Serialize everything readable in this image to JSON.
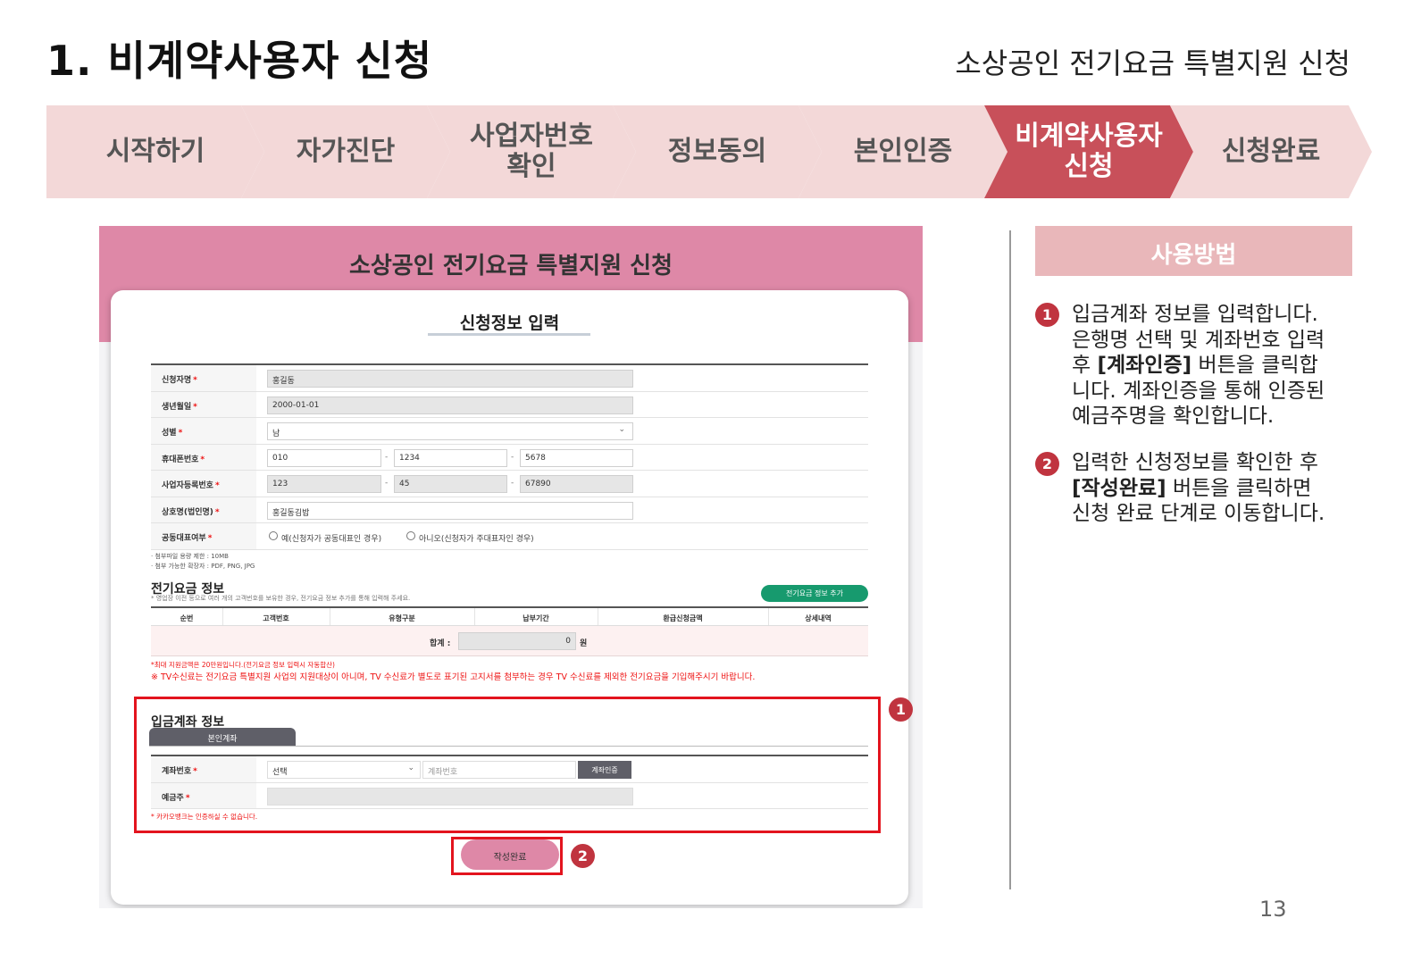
{
  "slide": {
    "title": "1. 비계약사용자 신청",
    "subtitle": "소상공인 전기요금 특별지원 신청",
    "page_number": "13"
  },
  "steps": [
    {
      "label": "시작하기",
      "active": false
    },
    {
      "label": "자가진단",
      "active": false
    },
    {
      "label": "사업자번호\n확인",
      "active": false
    },
    {
      "label": "정보동의",
      "active": false
    },
    {
      "label": "본인인증",
      "active": false
    },
    {
      "label": "비계약사용자\n신청",
      "active": true
    },
    {
      "label": "신청완료",
      "active": false
    }
  ],
  "app": {
    "banner_title": "소상공인 전기요금 특별지원 신청",
    "form_title": "신청정보 입력",
    "required_mark": "*",
    "applicant": {
      "name_label": "신청자명",
      "name_value": "홍길동",
      "birth_label": "생년월일",
      "birth_value": "2000-01-01",
      "gender_label": "성별",
      "gender_value": "남",
      "phone_label": "휴대폰번호",
      "phone_1": "010",
      "phone_2": "1234",
      "phone_3": "5678",
      "bizno_label": "사업자등록번호",
      "bizno_1": "123",
      "bizno_2": "45",
      "bizno_3": "67890",
      "company_label": "상호명(법인명)",
      "company_value": "홍길동김밥",
      "corep_label": "공동대표여부",
      "corep_yes": "예(신청자가 공동대표인 경우)",
      "corep_no": "아니오(신청자가 주대표자인 경우)",
      "separator": "-"
    },
    "attach_notes": [
      "· 첨부파일 용량 제한 : 10MB",
      "· 첨부 가능한 확장자 : PDF, PNG, JPG"
    ],
    "electric": {
      "title": "전기요금 정보",
      "subtitle": "* 영업장 이전 등으로 여러 개의 고객번호를 보유한 경우, 전기요금 정보 추가를 통해 입력해 주세요.",
      "add_button": "전기요금 정보 추가",
      "columns": [
        "순번",
        "고객번호",
        "유형구분",
        "납부기간",
        "환급신청금액",
        "상세내역"
      ],
      "sum_label": "합계 :",
      "sum_value": "0",
      "sum_unit": "원",
      "max_note": "*최대 지원금액은 20만원입니다.(전기요금 정보 입력시 자동합산)",
      "tv_note": "※ TV수신료는 전기요금 특별지원 사업의 지원대상이 아니며, TV 수신료가 별도로 표기된 고지서를 첨부하는 경우 TV 수신료를 제외한 전기요금을 기입해주시기 바랍니다."
    },
    "account": {
      "title": "입금계좌 정보",
      "tab": "본인계좌",
      "number_label": "계좌번호",
      "bank_select": "선택",
      "number_placeholder": "계좌번호",
      "verify_button": "계좌인증",
      "holder_label": "예금주",
      "kakao_note": "* 카카오뱅크는 인증하실 수 없습니다."
    },
    "submit_button": "작성완료",
    "markers": [
      "1",
      "2"
    ]
  },
  "usage": {
    "title": "사용방법",
    "steps": [
      {
        "num": "1",
        "line1": "입금계좌 정보를 입력합니다.",
        "line2": "은행명 선택 및 계좌번호 입력",
        "line3_pre": "후 ",
        "line3_bold": "[계좌인증]",
        "line3_post": " 버튼을 클릭합",
        "line4": "니다. 계좌인증을 통해 인증된",
        "line5": "예금주명을 확인합니다."
      },
      {
        "num": "2",
        "line1": "입력한 신청정보를 확인한 후",
        "line2_bold": "[작성완료]",
        "line2_post": " 버튼을 클릭하면",
        "line3": "신청 완료 단계로 이동합니다."
      }
    ]
  },
  "colors": {
    "accent": "#c8505a",
    "step_bg": "#f3d8d8",
    "banner": "#de88a7",
    "highlight": "#e3141e",
    "green": "#179a6e"
  }
}
